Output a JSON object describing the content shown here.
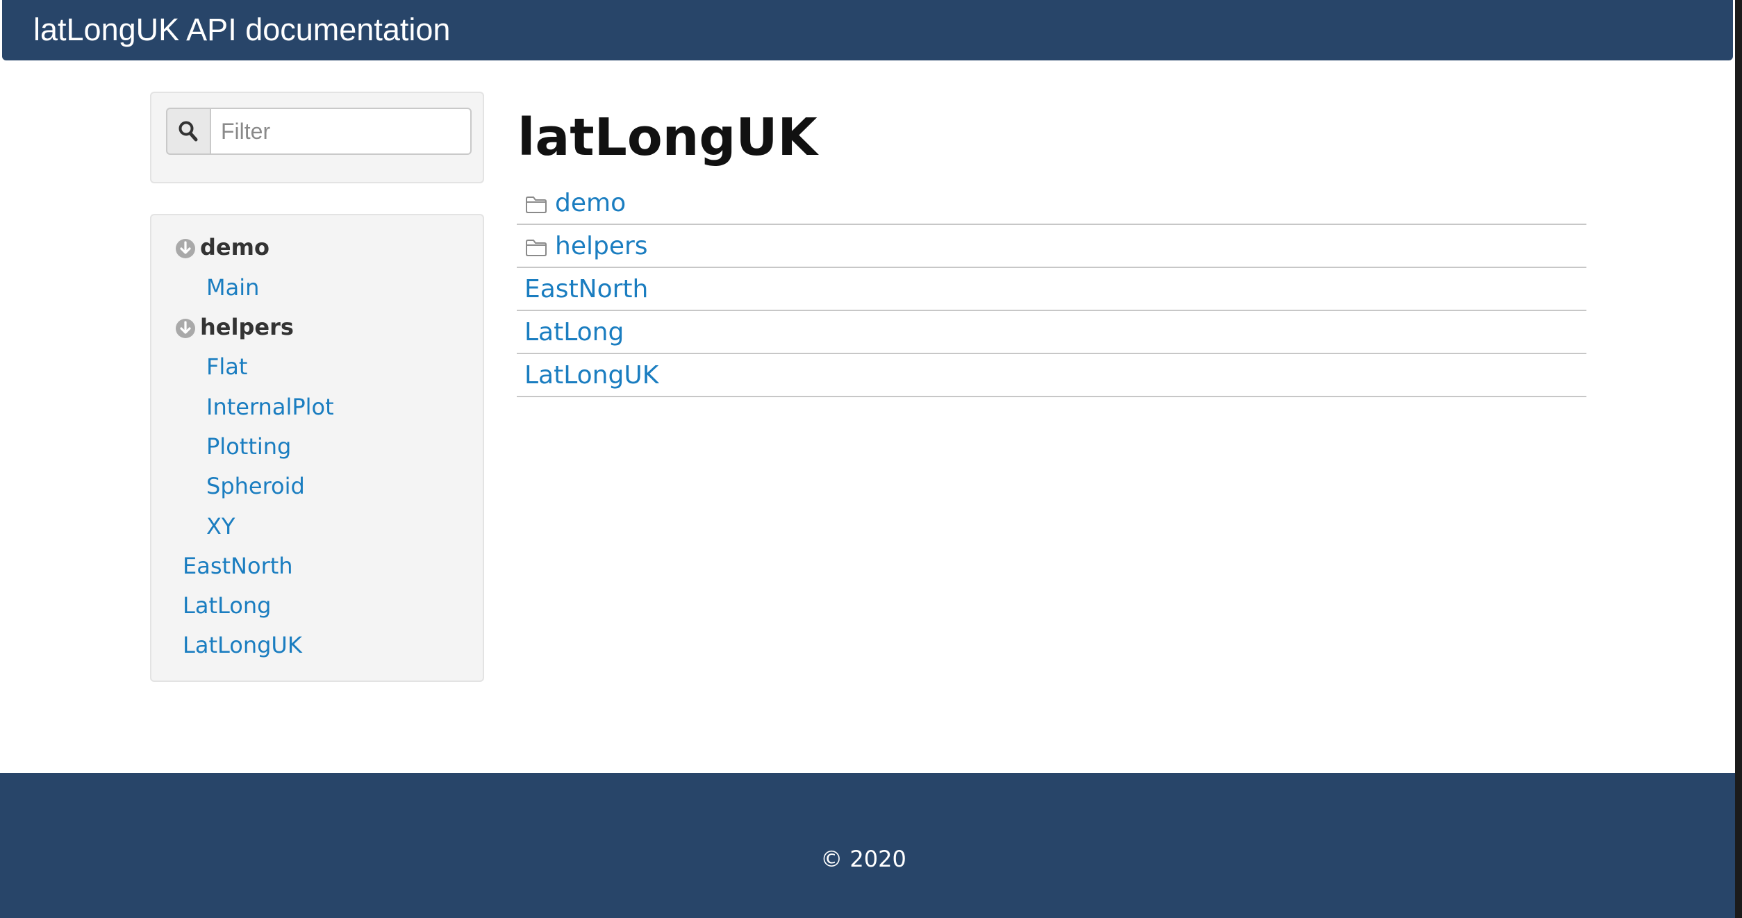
{
  "header": {
    "title": "latLongUK API documentation"
  },
  "search": {
    "placeholder": "Filter",
    "value": "",
    "icon": "search-icon"
  },
  "sidebar": {
    "groups": [
      {
        "label": "demo",
        "icon": "circle-arrow-down-icon",
        "items": [
          "Main"
        ]
      },
      {
        "label": "helpers",
        "icon": "circle-arrow-down-icon",
        "items": [
          "Flat",
          "InternalPlot",
          "Plotting",
          "Spheroid",
          "XY"
        ]
      }
    ],
    "modules": [
      "EastNorth",
      "LatLong",
      "LatLongUK"
    ]
  },
  "main": {
    "title": "latLongUK",
    "entries": [
      {
        "label": "demo",
        "icon": "folder-icon"
      },
      {
        "label": "helpers",
        "icon": "folder-icon"
      },
      {
        "label": "EastNorth"
      },
      {
        "label": "LatLong"
      },
      {
        "label": "LatLongUK"
      }
    ]
  },
  "footer": {
    "copyright": "© 2020"
  },
  "colors": {
    "header_bg": "#284569",
    "link": "#1a7dc0",
    "panel_bg": "#f4f4f4"
  }
}
